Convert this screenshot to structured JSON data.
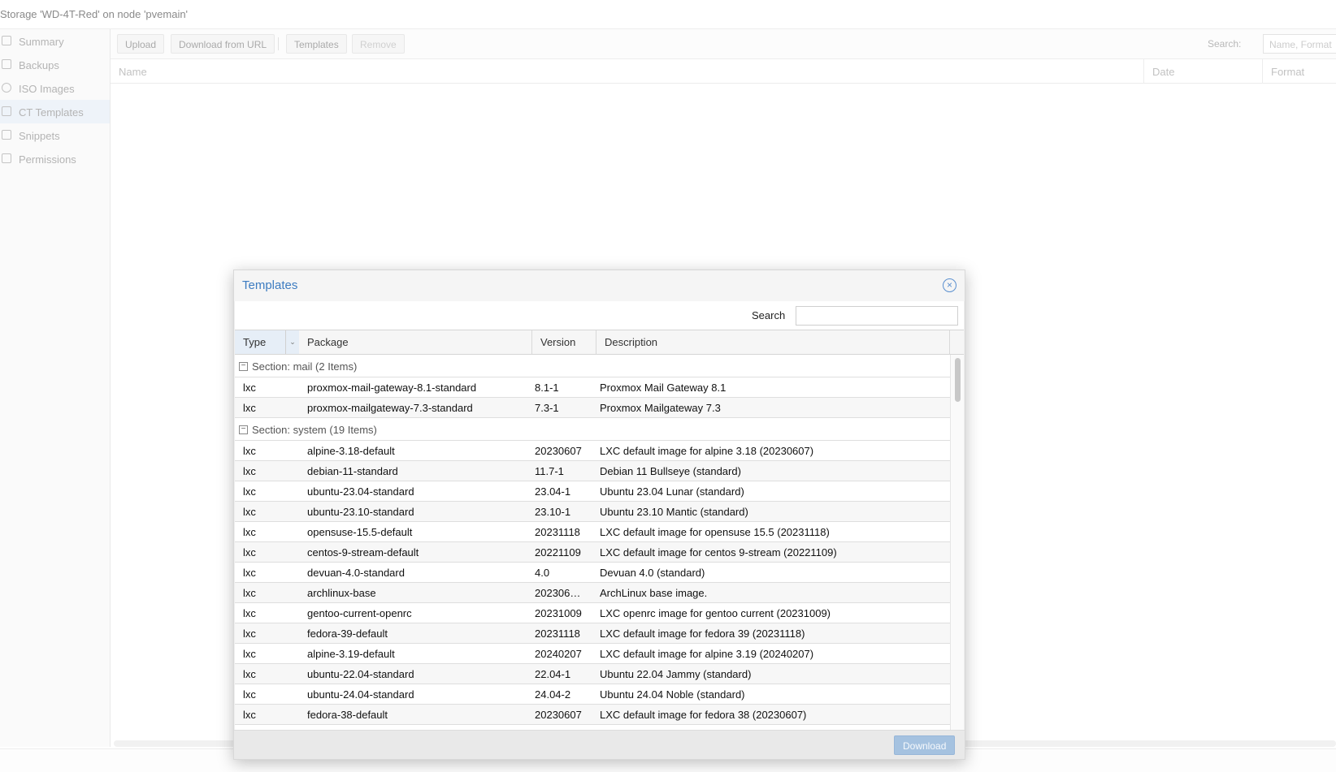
{
  "window": {
    "title": "Storage 'WD-4T-Red' on node 'pvemain'"
  },
  "sidebar": {
    "items": [
      {
        "label": "Summary",
        "icon": "book-icon"
      },
      {
        "label": "Backups",
        "icon": "floppy-icon"
      },
      {
        "label": "ISO Images",
        "icon": "disc-icon"
      },
      {
        "label": "CT Templates",
        "icon": "copy-icon",
        "active": true
      },
      {
        "label": "Snippets",
        "icon": "file-code-icon"
      },
      {
        "label": "Permissions",
        "icon": "unlock-icon"
      }
    ]
  },
  "toolbar": {
    "upload_label": "Upload",
    "download_url_label": "Download from URL",
    "templates_label": "Templates",
    "remove_label": "Remove",
    "search_label": "Search:",
    "search_placeholder": "Name, Format"
  },
  "content_grid": {
    "columns": [
      "Name",
      "Date",
      "Format"
    ]
  },
  "modal": {
    "title": "Templates",
    "search_label": "Search",
    "search_value": "",
    "columns": {
      "type": "Type",
      "package": "Package",
      "version": "Version",
      "description": "Description"
    },
    "groups": [
      {
        "label": "Section: mail (2 Items)",
        "rows": [
          {
            "type": "lxc",
            "package": "proxmox-mail-gateway-8.1-standard",
            "version": "8.1-1",
            "description": "Proxmox Mail Gateway 8.1"
          },
          {
            "type": "lxc",
            "package": "proxmox-mailgateway-7.3-standard",
            "version": "7.3-1",
            "description": "Proxmox Mailgateway 7.3"
          }
        ]
      },
      {
        "label": "Section: system (19 Items)",
        "rows": [
          {
            "type": "lxc",
            "package": "alpine-3.18-default",
            "version": "20230607",
            "description": "LXC default image for alpine 3.18 (20230607)"
          },
          {
            "type": "lxc",
            "package": "debian-11-standard",
            "version": "11.7-1",
            "description": "Debian 11 Bullseye (standard)"
          },
          {
            "type": "lxc",
            "package": "ubuntu-23.04-standard",
            "version": "23.04-1",
            "description": "Ubuntu 23.04 Lunar (standard)"
          },
          {
            "type": "lxc",
            "package": "ubuntu-23.10-standard",
            "version": "23.10-1",
            "description": "Ubuntu 23.10 Mantic (standard)"
          },
          {
            "type": "lxc",
            "package": "opensuse-15.5-default",
            "version": "20231118",
            "description": "LXC default image for opensuse 15.5 (20231118)"
          },
          {
            "type": "lxc",
            "package": "centos-9-stream-default",
            "version": "20221109",
            "description": "LXC default image for centos 9-stream (20221109)"
          },
          {
            "type": "lxc",
            "package": "devuan-4.0-standard",
            "version": "4.0",
            "description": "Devuan 4.0 (standard)"
          },
          {
            "type": "lxc",
            "package": "archlinux-base",
            "version": "202306…",
            "description": "ArchLinux base image."
          },
          {
            "type": "lxc",
            "package": "gentoo-current-openrc",
            "version": "20231009",
            "description": "LXC openrc image for gentoo current (20231009)"
          },
          {
            "type": "lxc",
            "package": "fedora-39-default",
            "version": "20231118",
            "description": "LXC default image for fedora 39 (20231118)"
          },
          {
            "type": "lxc",
            "package": "alpine-3.19-default",
            "version": "20240207",
            "description": "LXC default image for alpine 3.19 (20240207)"
          },
          {
            "type": "lxc",
            "package": "ubuntu-22.04-standard",
            "version": "22.04-1",
            "description": "Ubuntu 22.04 Jammy (standard)"
          },
          {
            "type": "lxc",
            "package": "ubuntu-24.04-standard",
            "version": "24.04-2",
            "description": "Ubuntu 24.04 Noble (standard)"
          },
          {
            "type": "lxc",
            "package": "fedora-38-default",
            "version": "20230607",
            "description": "LXC default image for fedora 38 (20230607)"
          }
        ]
      }
    ],
    "download_label": "Download"
  }
}
